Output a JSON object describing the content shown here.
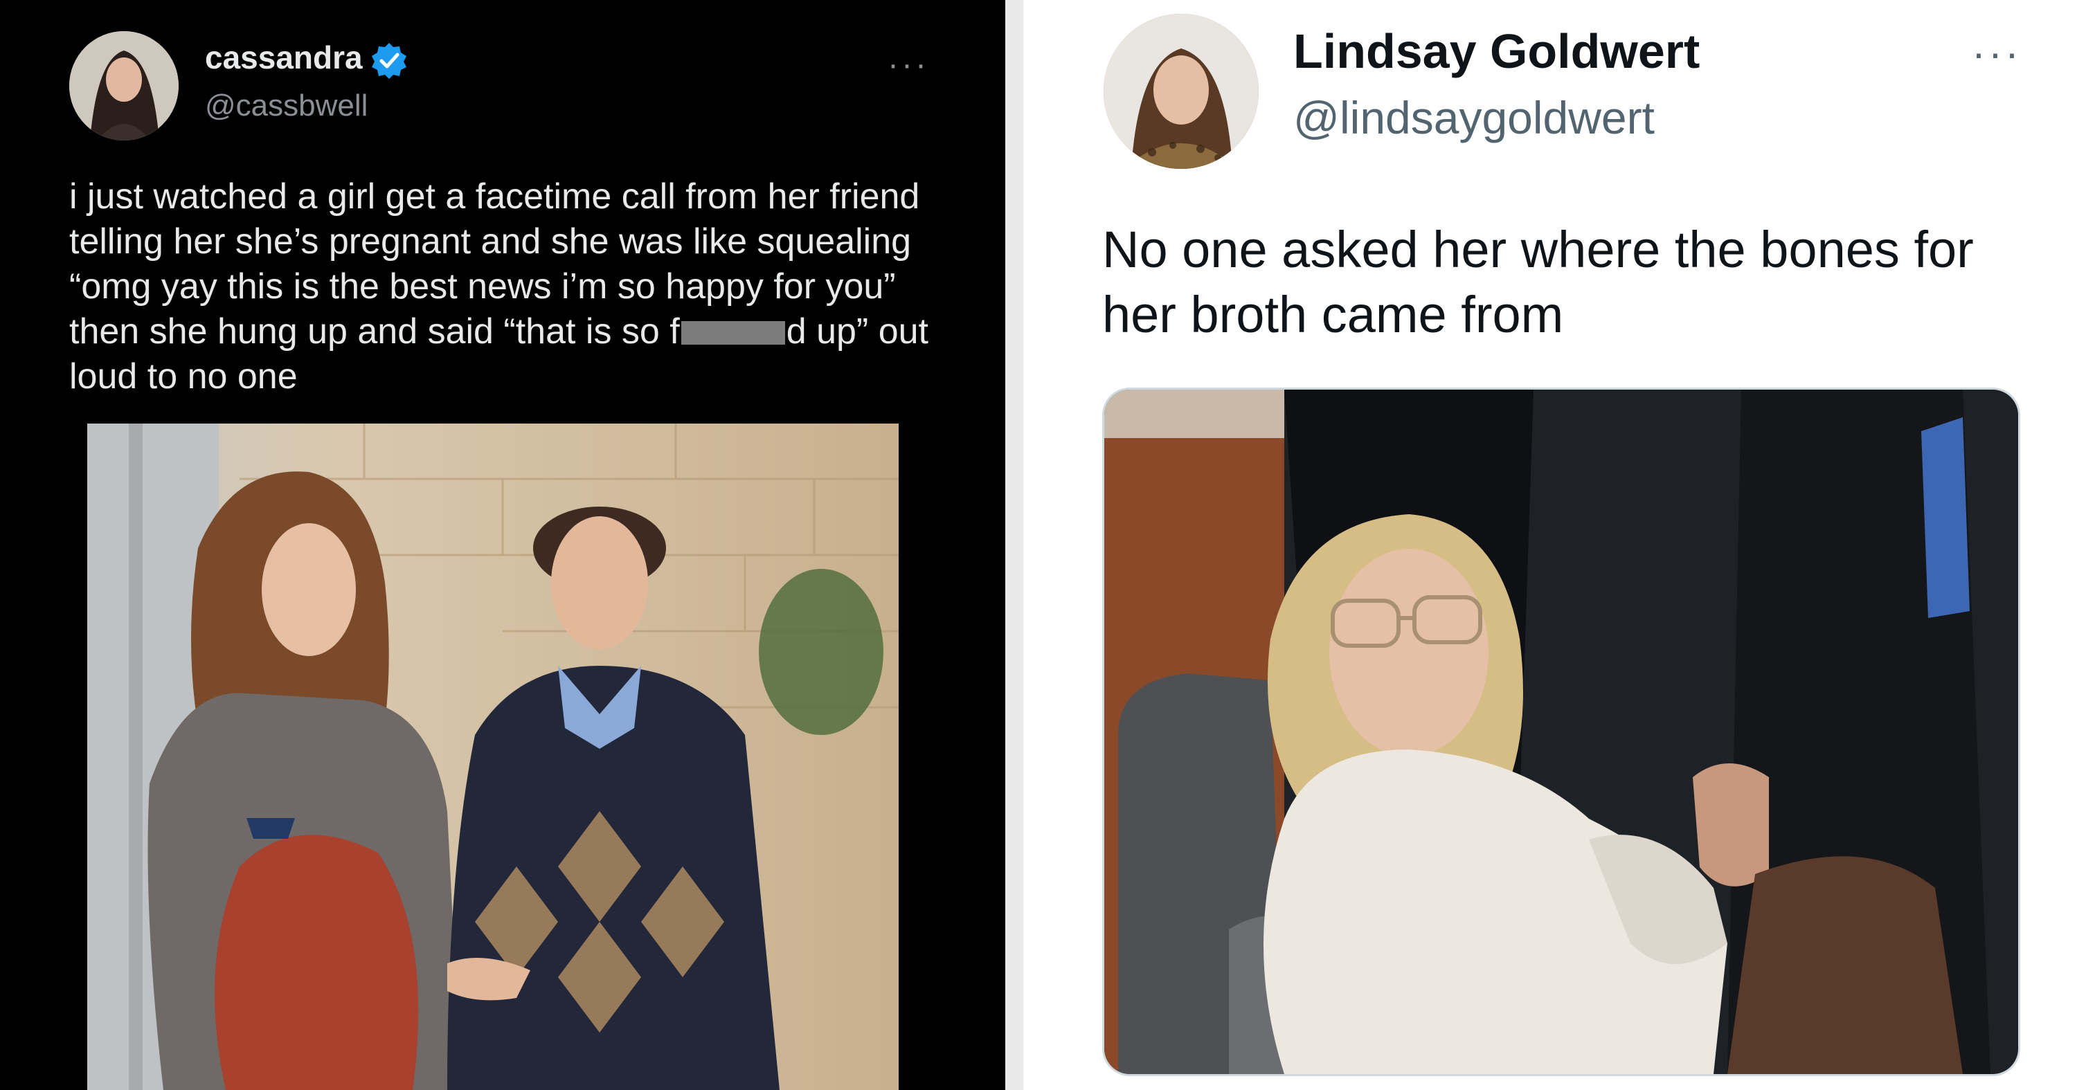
{
  "left_tweet": {
    "display_name": "cassandra",
    "handle": "@cassbwell",
    "verified_icon": "verified-badge-icon",
    "more_icon": "more-options-icon",
    "more_glyph": "···",
    "text_before_censor": "i just watched a girl get a facetime call from her friend telling her she’s pregnant and she was like squealing “omg yay this is the best news i’m so happy for you” then she hung up and said “that is so f",
    "text_after_censor": "d up” out loud to no one",
    "colors": {
      "background": "#000000",
      "text": "#e7e9ea",
      "secondary": "#8b8f94",
      "verified": "#1d9bf0"
    }
  },
  "right_tweet": {
    "display_name": "Lindsay Goldwert",
    "handle": "@lindsaygoldwert",
    "more_icon": "more-options-icon",
    "more_glyph": "···",
    "text": "No one asked her where the bones for her broth came from",
    "colors": {
      "background": "#ffffff",
      "text": "#0f1419",
      "secondary": "#536471"
    }
  }
}
